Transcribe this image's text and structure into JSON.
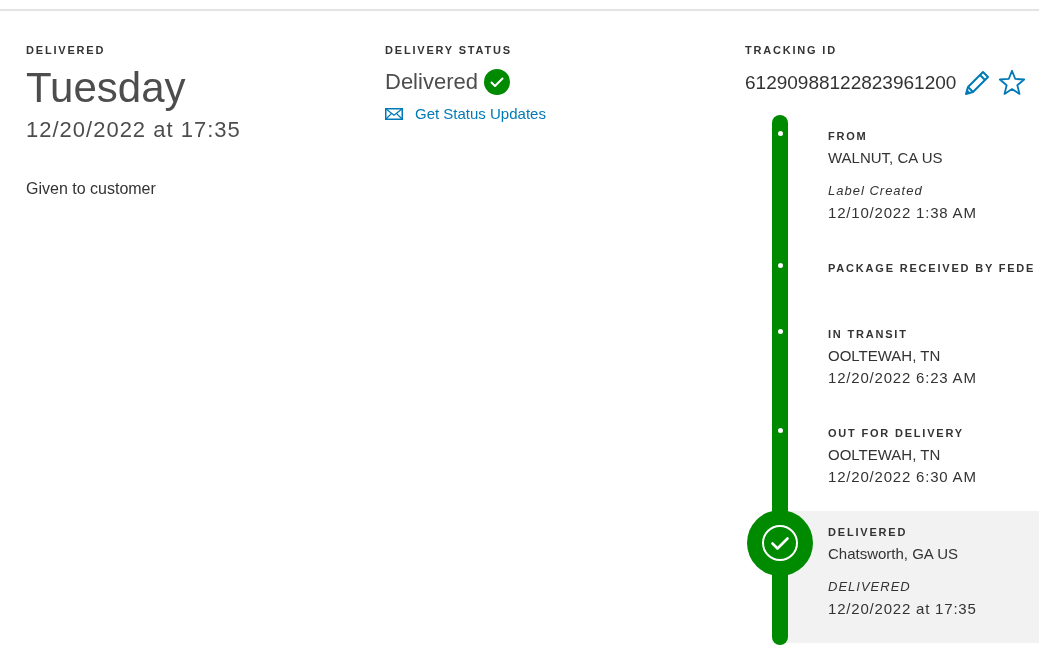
{
  "delivered": {
    "label": "DELIVERED",
    "day": "Tuesday",
    "datetime": "12/20/2022 at 17:35",
    "detail": "Given to customer"
  },
  "delivery_status": {
    "label": "DELIVERY STATUS",
    "status": "Delivered",
    "link": "Get Status Updates"
  },
  "tracking": {
    "label": "TRACKING ID",
    "number": "61290988122823961200",
    "starred": false
  },
  "timeline": {
    "events": [
      {
        "title": "FROM",
        "location": "WALNUT, CA US",
        "note": "Label Created",
        "time": "12/10/2022 1:38 AM",
        "current": false
      },
      {
        "title": "PACKAGE RECEIVED BY FEDE",
        "current": false
      },
      {
        "title": "IN TRANSIT",
        "location": "OOLTEWAH, TN",
        "time": "12/20/2022 6:23 AM",
        "current": false
      },
      {
        "title": "OUT FOR DELIVERY",
        "location": "OOLTEWAH, TN",
        "time": "12/20/2022 6:30 AM",
        "current": false
      },
      {
        "title": "DELIVERED",
        "location": "Chatsworth, GA US",
        "note": "DELIVERED",
        "time": "12/20/2022 at 17:35",
        "current": true
      }
    ]
  }
}
